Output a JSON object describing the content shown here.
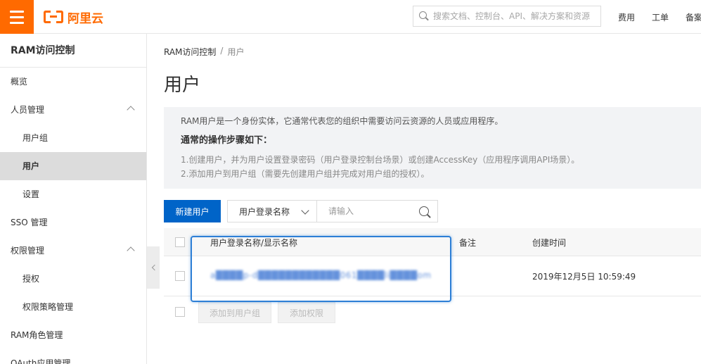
{
  "header": {
    "logo_text": "阿里云",
    "search_placeholder": "搜索文档、控制台、API、解决方案和资源",
    "nav": [
      "费用",
      "工单",
      "备案"
    ],
    "accent": "#ff6a00"
  },
  "sidebar": {
    "title": "RAM访问控制",
    "items": [
      {
        "label": "概览"
      },
      {
        "label": "人员管理"
      },
      {
        "label": "用户组"
      },
      {
        "label": "用户"
      },
      {
        "label": "设置"
      },
      {
        "label": "SSO 管理"
      },
      {
        "label": "权限管理"
      },
      {
        "label": "授权"
      },
      {
        "label": "权限策略管理"
      },
      {
        "label": "RAM角色管理"
      },
      {
        "label": "OAuth应用管理"
      }
    ]
  },
  "breadcrumb": {
    "root": "RAM访问控制",
    "sep": "/",
    "current": "用户"
  },
  "page_title": "用户",
  "info": {
    "desc": "RAM用户是一个身份实体，它通常代表您的组织中需要访问云资源的人员或应用程序。",
    "heading": "通常的操作步骤如下：",
    "steps": [
      "1.创建用户，并为用户设置登录密码（用户登录控制台场景）或创建AccessKey（应用程序调用API场景）。",
      "2.添加用户到用户组（需要先创建用户组并完成对用户组的授权）。"
    ]
  },
  "toolbar": {
    "create_label": "新建用户",
    "filter_selected": "用户登录名称",
    "query_placeholder": "请输入",
    "primary_color": "#0064c8"
  },
  "table": {
    "headers": [
      "用户登录名称/显示名称",
      "备注",
      "创建时间"
    ],
    "rows": [
      {
        "name": "a████p-d████████████061████li████om",
        "note": "",
        "created": "2019年12月5日 10:59:49"
      }
    ],
    "bulk_actions": [
      "添加到用户组",
      "添加权限"
    ]
  }
}
